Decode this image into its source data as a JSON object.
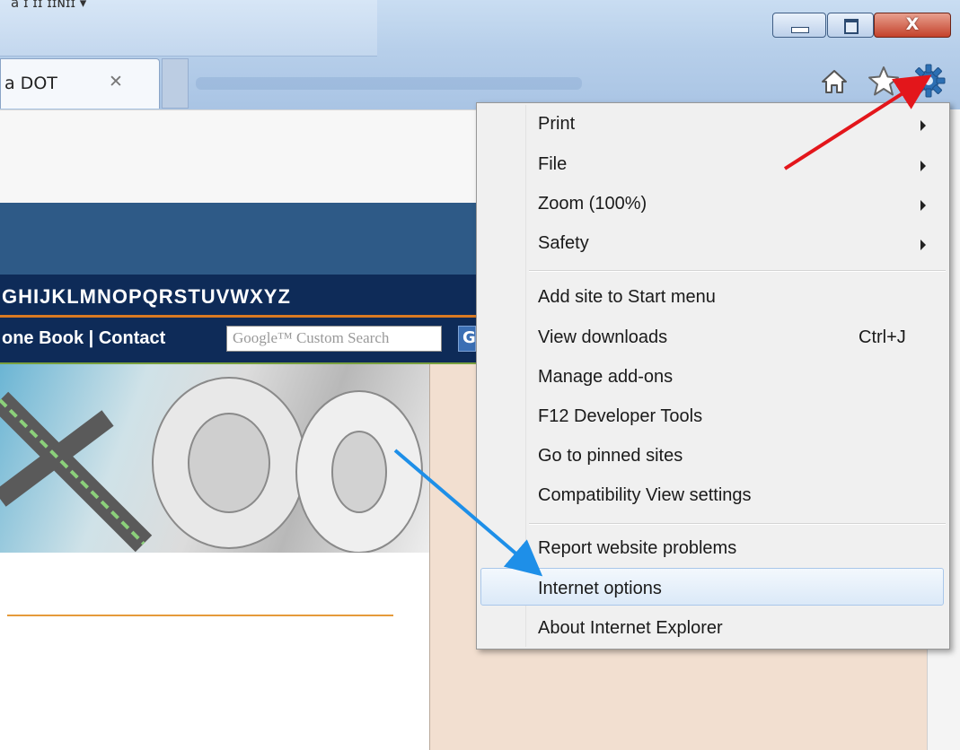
{
  "titlebar": {
    "partial_text": "a ɪ ɪɪ ɪɪɴɪɪ ▾"
  },
  "tab": {
    "title": "a DOT",
    "close_glyph": "✕"
  },
  "window": {
    "minimize": "",
    "maximize": "",
    "close": "X"
  },
  "toolbar": {
    "home": "home-icon",
    "favorites": "star-icon",
    "tools": "gear-icon"
  },
  "page": {
    "alphabet": "GHIJKLMNOPQRSTUVWXYZ",
    "nav_links": "one Book | Contact",
    "search_placeholder": "Google™ Custom Search",
    "search_button_partial": "G"
  },
  "menu": {
    "items": [
      {
        "label": "Print",
        "submenu": true
      },
      {
        "label": "File",
        "submenu": true
      },
      {
        "label": "Zoom (100%)",
        "submenu": true
      },
      {
        "label": "Safety",
        "submenu": true
      },
      {
        "label": "Add site to Start menu"
      },
      {
        "label": "View downloads",
        "shortcut": "Ctrl+J"
      },
      {
        "label": "Manage add-ons"
      },
      {
        "label": "F12 Developer Tools"
      },
      {
        "label": "Go to pinned sites"
      },
      {
        "label": "Compatibility View settings"
      },
      {
        "label": "Report website problems"
      },
      {
        "label": "Internet options",
        "highlighted": true
      },
      {
        "label": "About Internet Explorer"
      }
    ]
  },
  "annotations": {
    "arrow_red_color": "#e3161b",
    "arrow_blue_color": "#1e8fe8"
  }
}
